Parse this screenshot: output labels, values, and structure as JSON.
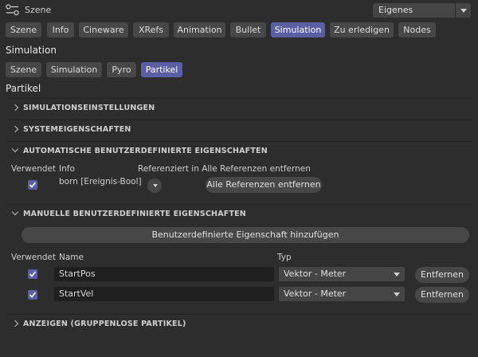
{
  "header": {
    "title": "Szene",
    "preset": "Eigenes"
  },
  "main_tabs": [
    "Szene",
    "Info",
    "Cineware",
    "XRefs",
    "Animation",
    "Bullet",
    "Simulation",
    "Zu erledigen",
    "Nodes"
  ],
  "main_tab_active": "Simulation",
  "section_heading": "Simulation",
  "sub_tabs": [
    "Szene",
    "Simulation",
    "Pyro",
    "Partikel"
  ],
  "sub_tab_active": "Partikel",
  "page_heading": "Partikel",
  "sections": {
    "sim_settings": "SIMULATIONSEINSTELLUNGEN",
    "system_props": "SYSTEMEIGENSCHAFTEN",
    "auto_props": "AUTOMATISCHE BENUTZERDEFINIERTE EIGENSCHAFTEN",
    "manual_props": "MANUELLE BENUTZERDEFINIERTE EIGENSCHAFTEN",
    "show_ungrouped": "ANZEIGEN (GRUPPENLOSE PARTIKEL)"
  },
  "auto": {
    "col_used": "Verwendet",
    "col_info": "Info",
    "col_ref": "Referenziert in Alle Referenzen entfernen",
    "row_info": "born [Ereignis-Bool]",
    "remove_all_button": "Alle Referenzen entfernen"
  },
  "manual": {
    "add_button": "Benutzerdefinierte Eigenschaft hinzufügen",
    "col_used": "Verwendet",
    "col_name": "Name",
    "col_type": "Typ",
    "rows": [
      {
        "name": "StartPos",
        "type": "Vektor - Meter",
        "remove": "Entfernen"
      },
      {
        "name": "StartVel",
        "type": "Vektor - Meter",
        "remove": "Entfernen"
      }
    ]
  },
  "colors": {
    "accent": "#5a5ea3",
    "background": "#2d2d2d",
    "button": "#474747"
  }
}
